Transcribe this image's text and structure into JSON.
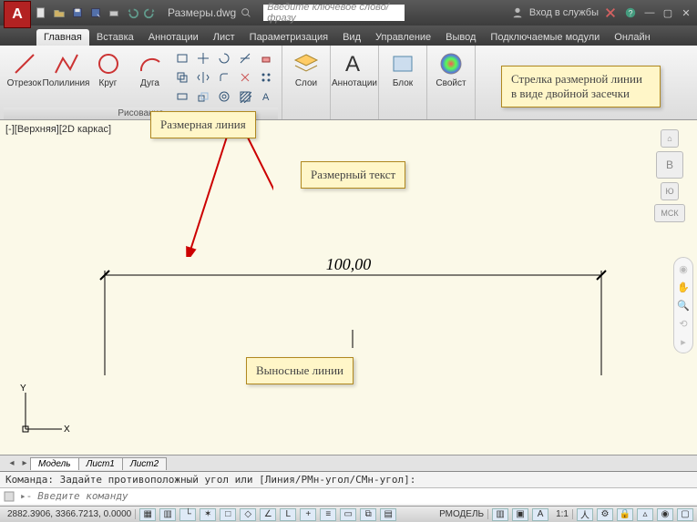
{
  "title_filename": "Размеры.dwg",
  "search_placeholder": "Введите ключевое слово/фразу",
  "login_label": "Вход в службы",
  "tabs": [
    "Главная",
    "Вставка",
    "Аннотации",
    "Лист",
    "Параметризация",
    "Вид",
    "Управление",
    "Вывод",
    "Подключаемые модули",
    "Онлайн"
  ],
  "active_tab": 0,
  "draw_group_label": "Рисование",
  "draw_buttons": [
    "Отрезок",
    "Полилиния",
    "Круг",
    "Дуга"
  ],
  "layer_label": "Слои",
  "annot_label": "Аннотации",
  "block_label": "Блок",
  "props_label": "Свойст",
  "view_label": "[-][Верхняя][2D каркас]",
  "dimension_value": "100,00",
  "callouts": {
    "dim_line": "Размерная линия",
    "dim_text": "Размерный текст",
    "ext_lines": "Выносные линии",
    "arrow_style": "Стрелка размерной линии в виде двойной засечки"
  },
  "cube_face": "В",
  "cube_compass": "Ю",
  "cube_wcs": "МСК",
  "model_tabs": [
    "Модель",
    "Лист1",
    "Лист2"
  ],
  "cmd_history": "Команда: Задайте противоположный угол или [Линия/РМн-угол/СМн-угол]:",
  "cmd_placeholder": "Введите команду",
  "status_coords": "2882.3906, 3366.7213, 0.0000",
  "status_model": "РМОДЕЛЬ",
  "status_scale": "1:1"
}
